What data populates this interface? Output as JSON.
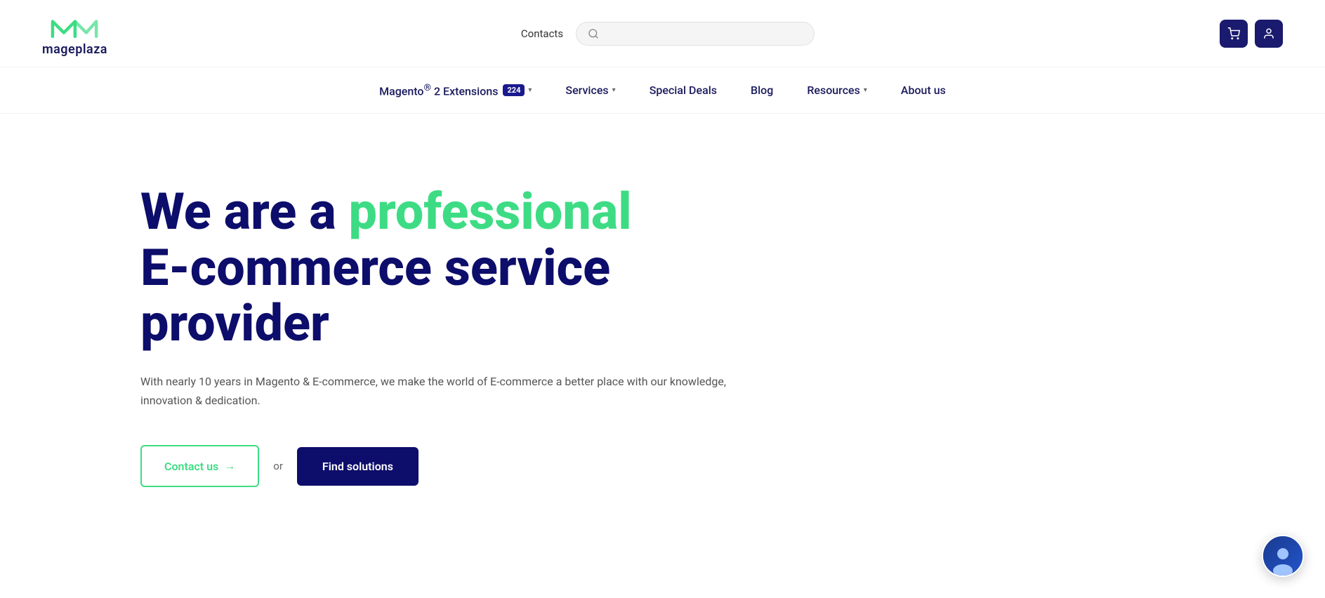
{
  "header": {
    "logo_text": "mageplaza",
    "contacts_label": "Contacts",
    "search_placeholder": ""
  },
  "nav": {
    "items": [
      {
        "label": "Magento® 2 Extensions",
        "badge": "224",
        "has_dropdown": true
      },
      {
        "label": "Services",
        "has_dropdown": true
      },
      {
        "label": "Special Deals",
        "has_dropdown": false
      },
      {
        "label": "Blog",
        "has_dropdown": false
      },
      {
        "label": "Resources",
        "has_dropdown": true
      },
      {
        "label": "About us",
        "has_dropdown": false
      }
    ]
  },
  "hero": {
    "heading_part1": "We are a ",
    "heading_highlight": "professional",
    "heading_part2": "E-commerce service",
    "heading_part3": "provider",
    "subtext": "With nearly 10 years in Magento & E-commerce, we make the world of E-commerce a better place with our knowledge, innovation & dedication.",
    "btn_contact_label": "Contact us",
    "btn_or_label": "or",
    "btn_find_label": "Find solutions"
  },
  "icons": {
    "search": "🔍",
    "cart": "🛒",
    "user": "👤",
    "chevron": "▾",
    "arrow": "→"
  },
  "colors": {
    "brand_dark": "#0d0d6b",
    "brand_green": "#3ddc84",
    "badge_bg": "#1a1a8e",
    "btn_dark": "#0d0d6b"
  }
}
